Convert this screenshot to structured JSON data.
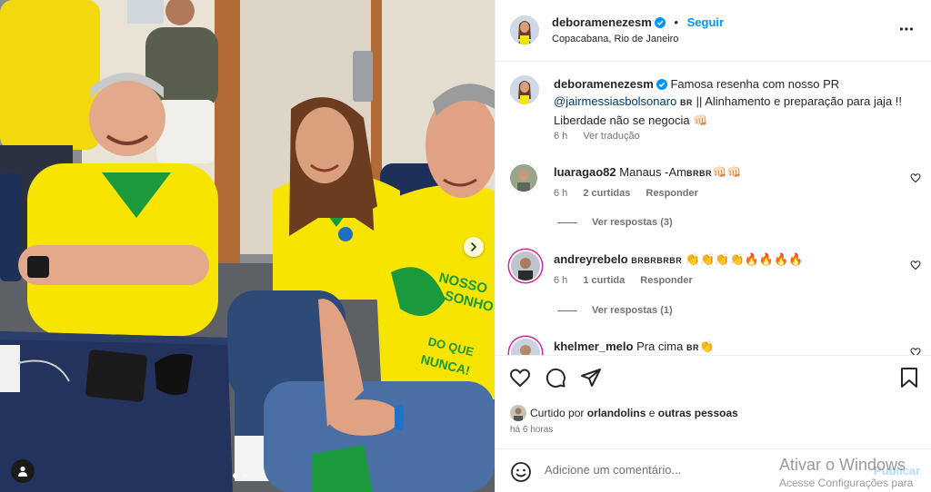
{
  "post": {
    "author": "deboramenezesm",
    "follow_label": "Seguir",
    "separator": "•",
    "location": "Copacabana, Rio de Janeiro",
    "caption_author": "deboramenezesm",
    "caption_part1": "Famosa resenha com nosso PR",
    "caption_mention": "@jairmessiasbolsonaro",
    "caption_flag": "BR",
    "caption_part2": "|| Alinhamento e preparação para jaja !! Liberdade não se negocia 👊🏻",
    "caption_time": "6 h",
    "translate_label": "Ver tradução"
  },
  "comments": [
    {
      "user": "luaragao82",
      "text": "Manaus -Am",
      "flags": "BRBR",
      "emoji": "👊🏻👊🏻",
      "time": "6 h",
      "likes": "2 curtidas",
      "reply_label": "Responder",
      "view_replies": "Ver respostas (3)"
    },
    {
      "user": "andreyrebelo",
      "flags": "BRBRBRBR",
      "emoji": "👏👏👏👏🔥🔥🔥🔥",
      "time": "6 h",
      "likes": "1 curtida",
      "reply_label": "Responder",
      "view_replies": "Ver respostas (1)"
    },
    {
      "user": "khelmer_melo",
      "text": "Pra cima",
      "flags": "BR",
      "emoji": "👏"
    }
  ],
  "likes": {
    "prefix": "Curtido por",
    "user": "orlandolins",
    "connector": "e",
    "others": "outras pessoas",
    "time_ago": "há 6 horas"
  },
  "composer": {
    "placeholder": "Adicione um comentário...",
    "publish_label": "Publicar"
  },
  "watermark": {
    "line1": "Ativar o Windows",
    "line2": "Acesse Configurações para"
  },
  "colors": {
    "accent": "#0095f6",
    "verified": "#0095f6",
    "jersey": "#f7e400",
    "jersey_green": "#1a9a3a"
  },
  "carousel": {
    "slides": 2,
    "active": 1
  }
}
